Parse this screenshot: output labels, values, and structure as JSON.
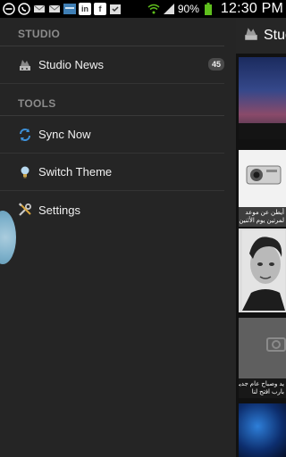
{
  "statusbar": {
    "battery": "90%",
    "time": "12:30 PM",
    "box_label_1": "in",
    "box_label_2": "f"
  },
  "drawer": {
    "sections": [
      {
        "title": "STUDIO",
        "items": [
          {
            "label": "Studio News",
            "icon": "studio-news-icon",
            "badge": "45"
          }
        ]
      },
      {
        "title": "TOOLS",
        "items": [
          {
            "label": "Sync Now",
            "icon": "sync-icon"
          },
          {
            "label": "Switch Theme",
            "icon": "lightbulb-icon"
          },
          {
            "label": "Settings",
            "icon": "settings-icon"
          }
        ]
      }
    ]
  },
  "main": {
    "title": "Studio",
    "tile_texts": [
      "أيطن عن موعد",
      "لمرتين يوم الأثنين",
      "يد وصباح عام جديد",
      "بارب افتح لنا"
    ]
  },
  "colors": {
    "drawer_bg": "#252525",
    "section_header": "#8b8b8b",
    "accent_handle": "#87c0dd",
    "battery": "#5fbf1d"
  }
}
